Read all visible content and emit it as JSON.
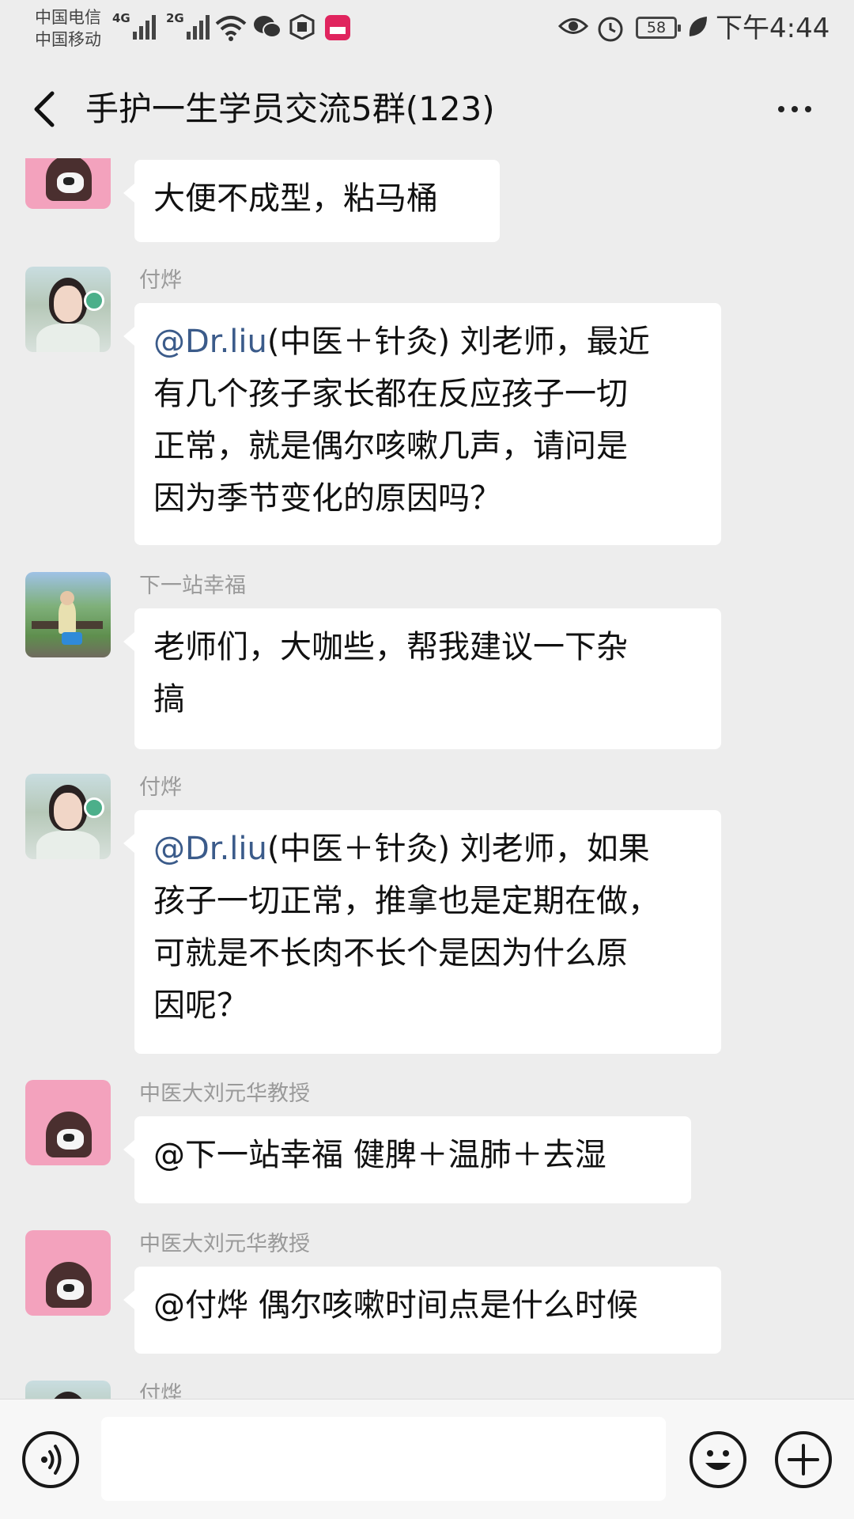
{
  "status_bar": {
    "carrier_1": "中国电信",
    "carrier_2": "中国移动",
    "net_1": "4G",
    "net_2": "2G",
    "battery": "58",
    "time": "下午4:44",
    "icons": [
      "wifi-icon",
      "wechat-icon",
      "shield-icon",
      "vmall-icon",
      "eye-icon",
      "alarm-icon",
      "battery-icon",
      "leaf-icon"
    ]
  },
  "header": {
    "title": "手护一生学员交流5群(123)",
    "back_icon": "chevron-left-icon",
    "more_icon": "more-dots-icon"
  },
  "messages": [
    {
      "sender": "",
      "avatar": "pink-cat",
      "text": "大便不成型，粘马桶"
    },
    {
      "sender": "付烨",
      "avatar": "lady",
      "mention": "@Dr.liu",
      "lines": [
        "(中医＋针灸) 刘老师，最近",
        "有几个孩子家长都在反应孩子一切",
        "正常，就是偶尔咳嗽几声，请问是",
        "因为季节变化的原因吗？"
      ]
    },
    {
      "sender": "下一站幸福",
      "avatar": "park",
      "lines": [
        "老师们，大咖些，帮我建议一下杂",
        "搞"
      ]
    },
    {
      "sender": "付烨",
      "avatar": "lady",
      "mention": "@Dr.liu",
      "lines": [
        "(中医＋针灸) 刘老师，如果",
        "孩子一切正常，推拿也是定期在做，",
        "可就是不长肉不长个是因为什么原",
        "因呢？"
      ]
    },
    {
      "sender": "中医大刘元华教授",
      "avatar": "pink-cat",
      "text": "@下一站幸福  健脾＋温肺＋去湿"
    },
    {
      "sender": "中医大刘元华教授",
      "avatar": "pink-cat",
      "text": "@付烨  偶尔咳嗽时间点是什么时候"
    },
    {
      "sender": "付烨",
      "avatar": "lady",
      "text": ""
    }
  ],
  "input_bar": {
    "voice_icon": "voice-icon",
    "emoji_icon": "emoji-icon",
    "plus_icon": "plus-icon",
    "placeholder": ""
  }
}
